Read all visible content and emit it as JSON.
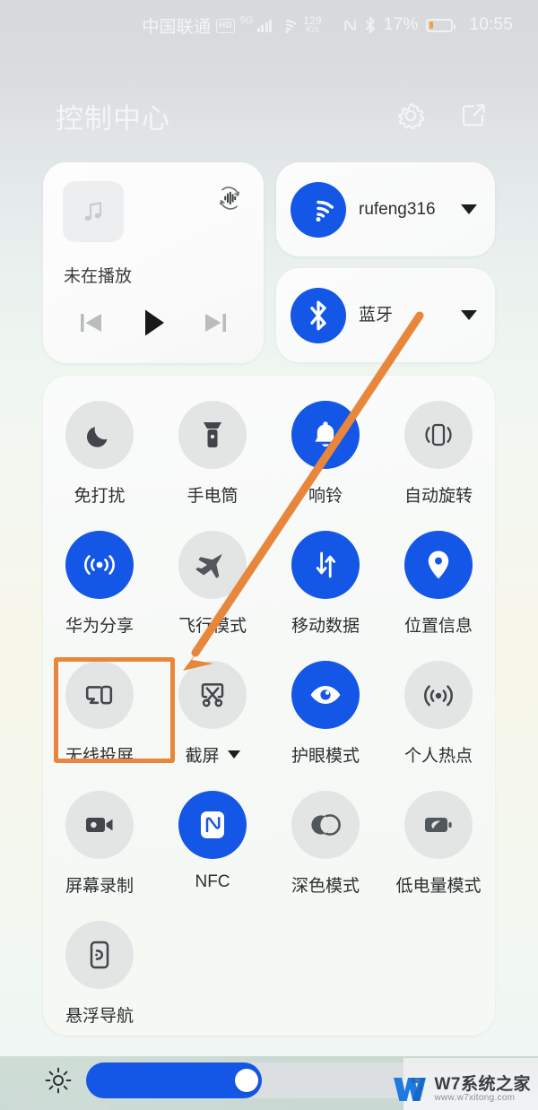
{
  "statusbar": {
    "carrier": "中国联通",
    "hd_badge": "HD",
    "network_gen": "5G",
    "speed_value": "129",
    "speed_unit": "K/s",
    "nfc_icon": "nfc-icon",
    "bluetooth_icon": "bluetooth-icon",
    "battery_percent": "17%",
    "clock": "10:55"
  },
  "header": {
    "title": "控制中心",
    "settings_icon": "gear-icon",
    "edit_icon": "edit-square-icon"
  },
  "media": {
    "art_icon": "music-note-icon",
    "cast_icon": "audio-output-icon",
    "title": "未在播放",
    "prev_icon": "previous-track-icon",
    "play_icon": "play-icon",
    "next_icon": "next-track-icon"
  },
  "connectivity": [
    {
      "id": "wifi",
      "icon": "wifi-icon",
      "label": "rufeng316",
      "active": true,
      "caret": true
    },
    {
      "id": "bluetooth",
      "icon": "bluetooth-icon",
      "label": "蓝牙",
      "active": true,
      "caret": true
    }
  ],
  "toggles": [
    [
      {
        "id": "dnd",
        "label": "免打扰",
        "icon": "moon-icon",
        "active": false,
        "caret": false
      },
      {
        "id": "flashlight",
        "label": "手电筒",
        "icon": "flashlight-icon",
        "active": false,
        "caret": false
      },
      {
        "id": "ringer",
        "label": "响铃",
        "icon": "bell-icon",
        "active": true,
        "caret": false
      },
      {
        "id": "autorotate",
        "label": "自动旋转",
        "icon": "rotate-icon",
        "active": false,
        "caret": false
      }
    ],
    [
      {
        "id": "huaweishare",
        "label": "华为分享",
        "icon": "share-waves-icon",
        "active": true,
        "caret": false
      },
      {
        "id": "airplane",
        "label": "飞行模式",
        "icon": "airplane-icon",
        "active": false,
        "caret": false
      },
      {
        "id": "mobiledata",
        "label": "移动数据",
        "icon": "data-arrows-icon",
        "active": true,
        "caret": false
      },
      {
        "id": "location",
        "label": "位置信息",
        "icon": "location-pin-icon",
        "active": true,
        "caret": false
      }
    ],
    [
      {
        "id": "cast",
        "label": "无线投屏",
        "icon": "screencast-icon",
        "active": false,
        "caret": false
      },
      {
        "id": "screenshot",
        "label": "截屏",
        "icon": "scissors-icon",
        "active": false,
        "caret": true
      },
      {
        "id": "eyecomfort",
        "label": "护眼模式",
        "icon": "eye-icon",
        "active": true,
        "caret": false
      },
      {
        "id": "hotspot",
        "label": "个人热点",
        "icon": "hotspot-icon",
        "active": false,
        "caret": false
      }
    ],
    [
      {
        "id": "screenrec",
        "label": "屏幕录制",
        "icon": "video-camera-icon",
        "active": false,
        "caret": false
      },
      {
        "id": "nfc",
        "label": "NFC",
        "icon": "nfc-icon",
        "active": true,
        "caret": false
      },
      {
        "id": "darkmode",
        "label": "深色模式",
        "icon": "contrast-icon",
        "active": false,
        "caret": false
      },
      {
        "id": "powersave",
        "label": "低电量模式",
        "icon": "battery-leaf-icon",
        "active": false,
        "caret": false
      }
    ],
    [
      {
        "id": "floatnav",
        "label": "悬浮导航",
        "icon": "floating-nav-icon",
        "active": false,
        "caret": false
      }
    ]
  ],
  "brightness": {
    "icon": "brightness-sun-icon",
    "value_percent": 43
  },
  "annotations": {
    "highlight_box": "无线投屏",
    "arrow_icon": "arrow-pointer"
  },
  "watermark": {
    "logo": "w7-logo-icon",
    "title": "W7系统之家",
    "url": "www.w7xitong.com"
  },
  "colors": {
    "accent_blue": "#1457e6",
    "annotation_orange": "#e8873c",
    "battery_orange": "#f2a03c",
    "toggle_off_bg": "#e2e5e4"
  }
}
